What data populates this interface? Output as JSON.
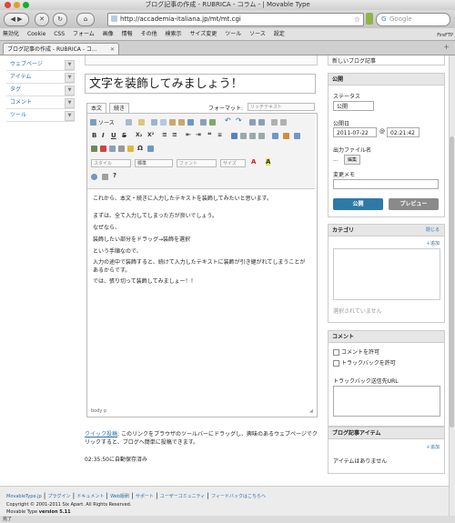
{
  "window": {
    "title": "ブログ記事の作成 - RUBRICA - コラム - | Movable Type"
  },
  "browser": {
    "url": "http://accademia-italiana.jp/mt/mt.cgi",
    "search_placeholder": "Google",
    "bookmarks": [
      "無効化",
      "Cookie",
      "CSS",
      "フォーム",
      "画像",
      "情報",
      "その他",
      "検索示",
      "サイズ変更",
      "ツール",
      "ソース",
      "設定"
    ],
    "firefp": "FireFTP",
    "tab_label": "ブログ記事の作成 - RUBRICA - コ...",
    "status": "完了"
  },
  "topbar": {
    "right_label": "新しいブログ記事"
  },
  "left_nav": [
    {
      "label": "ウェブページ"
    },
    {
      "label": "アイテム"
    },
    {
      "label": "タグ"
    },
    {
      "label": "コメント"
    },
    {
      "label": "ツール"
    }
  ],
  "entry": {
    "title": "文字を装飾してみましょう！",
    "tabs": [
      "本文",
      "続き"
    ],
    "format_label": "フォーマット:",
    "format_value": "リッチテキスト",
    "toolbar": {
      "source": "ソース",
      "style": "スタイル",
      "style_value": "標準",
      "font": "フォント",
      "size": "サイズ"
    },
    "body": [
      "これから、本文・続きに入力したテキストを装飾してみたいと思います。",
      "まずは、全て入力してしまった方が良いでしょう。",
      "なぜなら、",
      "装飾したい部分をドラッグ→装飾を選択",
      "という手順なので、",
      "入力の途中で装飾すると、続けて入力したテキストに装飾が引き継がれてしまうことがあるからです。",
      "では、張り切って装飾してみましょー！！"
    ],
    "path": "body  p"
  },
  "quickpost": {
    "link": "クイック投稿",
    "text": ": このリンクをブラウザのツールバーにドラッグし、興味のあるウェブページでクリックすると、ブログへ簡単に投稿できます。",
    "autosave": "02:35:50に自動保存済み"
  },
  "publish": {
    "heading": "公開",
    "status_label": "ステータス",
    "status_value": "公開",
    "date_label": "公開日",
    "date_value": "2011-07-22",
    "at": "@",
    "time_value": "02:21:42",
    "filename_label": "出力ファイル名",
    "filename_value": "...",
    "edit_button": "編集",
    "memo_label": "変更メモ",
    "publish_button": "公開",
    "preview_button": "プレビュー"
  },
  "category": {
    "heading": "カテゴリ",
    "close": "閉じる",
    "add": "追加",
    "none": "選択されていません"
  },
  "comments": {
    "heading": "コメント",
    "allow_comments": "コメントを許可",
    "allow_trackbacks": "トラックバックを許可",
    "trackback_url_label": "トラックバック送信先URL"
  },
  "items": {
    "heading": "ブログ記事アイテム",
    "add": "追加",
    "none": "アイテムはありません"
  },
  "footer": {
    "links": [
      "MovableType.jp",
      "プラグイン",
      "ドキュメント",
      "Web版刷",
      "サポート",
      "ユーザーコミュニティ",
      "フィードバックはこちらへ"
    ],
    "copyright": "Copyright © 2001-2011 Six Apart. All Rights Reserved.",
    "version_prefix": "Movable Type",
    "version": "version 5.11"
  }
}
